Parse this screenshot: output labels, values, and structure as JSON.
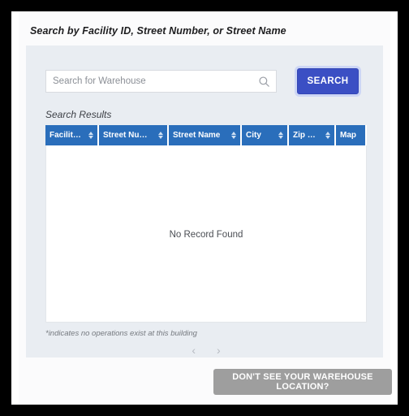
{
  "page": {
    "title": "Search by Facility ID, Street Number, or Street Name"
  },
  "search": {
    "placeholder": "Search for Warehouse",
    "value": "",
    "icon": "search-icon",
    "button_label": "SEARCH",
    "button_color": "#3b4fc4"
  },
  "results": {
    "label": "Search Results",
    "empty_message": "No Record Found",
    "header_color": "#2a6ebb",
    "columns": [
      {
        "label": "Facility ID",
        "sortable": true
      },
      {
        "label": "Street Number",
        "sortable": true
      },
      {
        "label": "Street Name",
        "sortable": true
      },
      {
        "label": "City",
        "sortable": true
      },
      {
        "label": "Zip Code",
        "sortable": true
      },
      {
        "label": "Map",
        "sortable": false
      }
    ],
    "rows": []
  },
  "footnote": "*indicates no operations exist at this building",
  "pagination": {
    "prev": "‹",
    "next": "›"
  },
  "bottom": {
    "no_location_label": "DON'T SEE YOUR WAREHOUSE LOCATION?",
    "no_location_color": "#9e9e9e"
  }
}
